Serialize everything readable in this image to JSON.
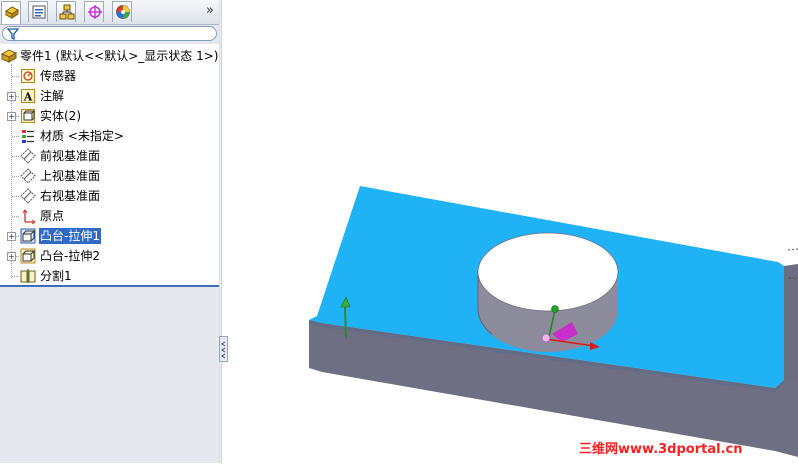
{
  "feature_tree": {
    "tabs": [
      {
        "name": "featuremanager-tab",
        "icon": "featuremanager-tree-icon"
      },
      {
        "name": "propertymanager-tab",
        "icon": "property-sheet-icon"
      },
      {
        "name": "configurationmanager-tab",
        "icon": "configuration-icon"
      },
      {
        "name": "dimxpertmanager-tab",
        "icon": "crosshair-target-icon"
      },
      {
        "name": "display-manager-tab",
        "icon": "color-wheel-icon"
      }
    ],
    "more_label": "»",
    "root": {
      "label": "零件1 (默认<<默认>_显示状态 1>)",
      "icon": "part-icon"
    },
    "items": [
      {
        "label": "传感器",
        "icon": "sensor-icon",
        "expandable": false
      },
      {
        "label": "注解",
        "icon": "annotation-icon",
        "expandable": true
      },
      {
        "label": "实体(2)",
        "icon": "solid-bodies-icon",
        "expandable": true
      },
      {
        "label": "材质 <未指定>",
        "icon": "material-icon",
        "expandable": false
      },
      {
        "label": "前视基准面",
        "icon": "plane-icon",
        "expandable": false
      },
      {
        "label": "上视基准面",
        "icon": "plane-icon",
        "expandable": false
      },
      {
        "label": "右视基准面",
        "icon": "plane-icon",
        "expandable": false
      },
      {
        "label": "原点",
        "icon": "origin-icon",
        "expandable": false
      },
      {
        "label": "凸台-拉伸1",
        "icon": "boss-extrude-icon",
        "expandable": true,
        "selected": true
      },
      {
        "label": "凸台-拉伸2",
        "icon": "boss-extrude-icon",
        "expandable": true
      },
      {
        "label": "分割1",
        "icon": "split-icon",
        "expandable": false
      }
    ]
  },
  "viewport": {
    "model_top_color": "#1fb3f5",
    "model_side_color": "#6f6f83",
    "cylinder_top_color": "#ffffff",
    "cylinder_side_color": "#8c8c9c",
    "triad_icon": "reference-triad-icon"
  },
  "watermark": "三维网www.3dportal.cn"
}
